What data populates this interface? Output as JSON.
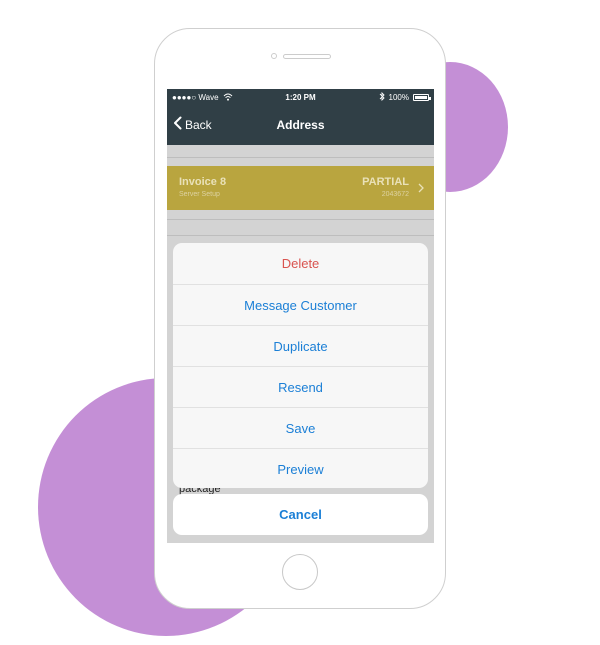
{
  "status_bar": {
    "carrier": "●●●●○ Wave",
    "time": "1:20 PM",
    "battery": "100%"
  },
  "nav": {
    "back_label": "Back",
    "title": "Address"
  },
  "invoice": {
    "title": "Invoice 8",
    "subtitle": "Server Setup",
    "status": "PARTIAL",
    "number": "2043672"
  },
  "background_text": "package",
  "action_sheet": {
    "items": [
      {
        "label": "Delete"
      },
      {
        "label": "Message Customer"
      },
      {
        "label": "Duplicate"
      },
      {
        "label": "Resend"
      },
      {
        "label": "Save"
      },
      {
        "label": "Preview"
      }
    ],
    "cancel_label": "Cancel"
  },
  "colors": {
    "navbar": "#303f46",
    "invoice_band": "#b9a53f",
    "action_blue": "#1b7fd6",
    "destructive_red": "#d9534f",
    "blob_purple": "#c48fd6"
  },
  "icons": {
    "wifi": "wifi-icon",
    "bluetooth": "bluetooth-icon",
    "battery": "battery-icon",
    "back": "chevron-left-icon",
    "row_chevron": "chevron-right-icon"
  }
}
